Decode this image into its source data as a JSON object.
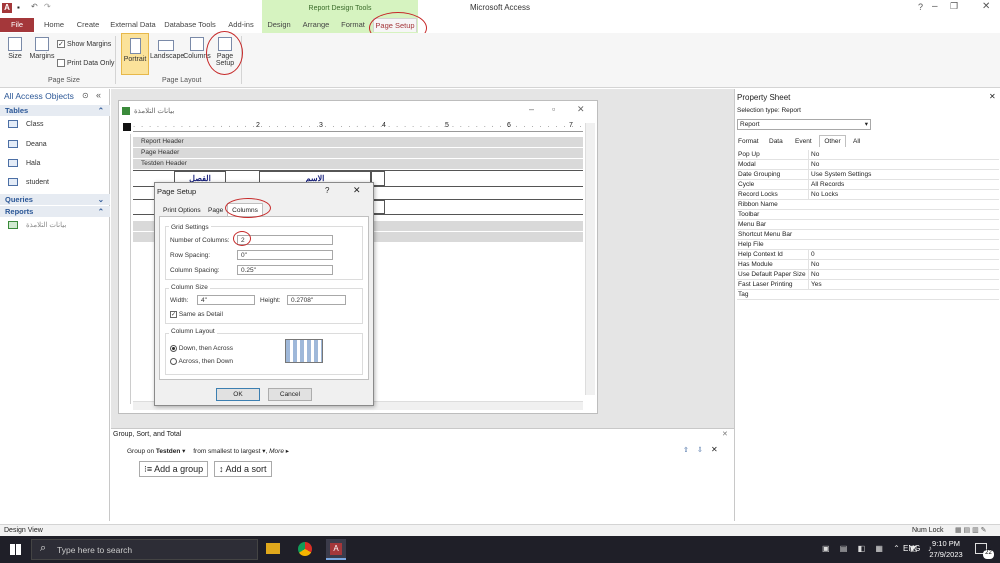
{
  "window": {
    "title": "Microsoft Access",
    "context_tab": "Report Design Tools"
  },
  "ribbon_tabs": [
    "File",
    "Home",
    "Create",
    "External Data",
    "Database Tools",
    "Add-ins",
    "Design",
    "Arrange",
    "Format",
    "Page Setup"
  ],
  "ribbon": {
    "size": "Size",
    "margins": "Margins",
    "show_margins": "Show Margins",
    "print_data_only": "Print Data Only",
    "portrait": "Portrait",
    "landscape": "Landscape",
    "columns": "Columns",
    "page_setup": "Page Setup",
    "group_page_size": "Page Size",
    "group_page_layout": "Page Layout"
  },
  "nav": {
    "title": "All Access Objects",
    "tables_header": "Tables",
    "tables": [
      "Class",
      "Deana",
      "Hala",
      "student"
    ],
    "queries_header": "Queries",
    "reports_header": "Reports",
    "reports": [
      "بيانات التلامذة"
    ]
  },
  "design": {
    "window_title": "بيانات التلامذة",
    "bands": [
      "Report Header",
      "Page Header",
      "Testden Header"
    ],
    "labels": [
      "الفصل",
      "الاسم"
    ],
    "ruler_numbers": [
      "2",
      "3",
      "4",
      "5",
      "6",
      "7"
    ]
  },
  "dialog": {
    "title": "Page Setup",
    "help": "?",
    "tabs": [
      "Print Options",
      "Page",
      "Columns"
    ],
    "grid_settings": "Grid Settings",
    "num_columns_label": "Number of Columns:",
    "num_columns": "2",
    "row_spacing_label": "Row Spacing:",
    "row_spacing": "0\"",
    "column_spacing_label": "Column Spacing:",
    "column_spacing": "0.25\"",
    "column_size": "Column Size",
    "width_label": "Width:",
    "width": "4\"",
    "height_label": "Height:",
    "height": "0.2708\"",
    "same_as_detail": "Same as Detail",
    "column_layout": "Column Layout",
    "down_then_across": "Down, then Across",
    "across_then_down": "Across, then Down",
    "ok": "OK",
    "cancel": "Cancel"
  },
  "property_sheet": {
    "title": "Property Sheet",
    "selection_type": "Selection type:  Report",
    "selected": "Report",
    "tabs": [
      "Format",
      "Data",
      "Event",
      "Other",
      "All"
    ],
    "rows": [
      {
        "k": "Pop Up",
        "v": "No"
      },
      {
        "k": "Modal",
        "v": "No"
      },
      {
        "k": "Date Grouping",
        "v": "Use System Settings"
      },
      {
        "k": "Cycle",
        "v": "All Records"
      },
      {
        "k": "Record Locks",
        "v": "No Locks"
      },
      {
        "k": "Ribbon Name",
        "v": ""
      },
      {
        "k": "Toolbar",
        "v": ""
      },
      {
        "k": "Menu Bar",
        "v": ""
      },
      {
        "k": "Shortcut Menu Bar",
        "v": ""
      },
      {
        "k": "Help File",
        "v": ""
      },
      {
        "k": "Help Context Id",
        "v": "0"
      },
      {
        "k": "Has Module",
        "v": "No"
      },
      {
        "k": "Use Default Paper Size",
        "v": "No"
      },
      {
        "k": "Fast Laser Printing",
        "v": "Yes"
      },
      {
        "k": "Tag",
        "v": ""
      }
    ]
  },
  "group_sort": {
    "title": "Group, Sort, and Total",
    "group_on": "Group on",
    "field": "Testden",
    "order": "from smallest to largest",
    "more": "More",
    "add_group": "Add a group",
    "add_sort": "Add a sort"
  },
  "status": {
    "left": "Design View",
    "right": "Num Lock"
  },
  "taskbar": {
    "search": "Type here to search",
    "lang": "ENG",
    "time": "9:10 PM",
    "date": "27/9/2023",
    "notif": "22"
  },
  "colors": {
    "accent": "#a4373a",
    "context": "#d6f3c0",
    "annotation": "#c62828"
  }
}
